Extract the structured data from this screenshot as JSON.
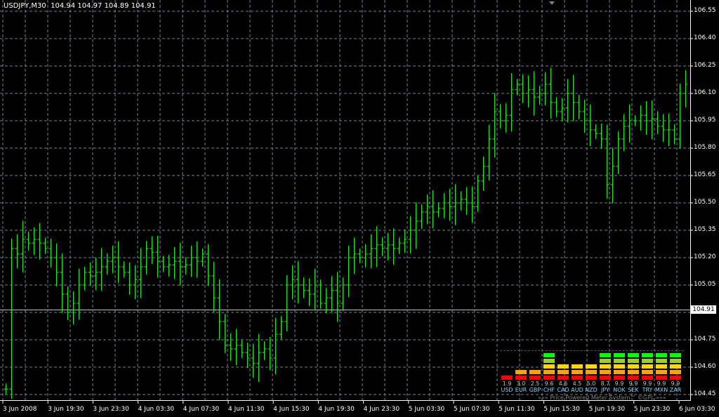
{
  "header": {
    "symbol": "USDJPY,M30",
    "open": "104.94",
    "high": "104.97",
    "low": "104.89",
    "close": "104.91"
  },
  "current_price": "104.91",
  "colors": {
    "bar": "#00ff00",
    "grid": "#708090",
    "axis": "#ffffff",
    "bid_line": "#c0c0c0"
  },
  "chart_data": {
    "type": "ohlc",
    "title": "USDJPY,M30",
    "ylim": [
      104.4,
      106.62
    ],
    "price_ticks": [
      "106.55",
      "106.40",
      "106.25",
      "106.10",
      "105.95",
      "105.80",
      "105.65",
      "105.50",
      "105.35",
      "105.20",
      "105.05",
      "104.90",
      "104.75",
      "104.60",
      "104.45"
    ],
    "time_ticks": [
      "3 Jun 2008",
      "3 Jun 19:30",
      "3 Jun 23:30",
      "4 Jun 03:30",
      "4 Jun 07:30",
      "4 Jun 11:30",
      "4 Jun 15:30",
      "4 Jun 19:30",
      "4 Jun 23:30",
      "5 Jun 03:30",
      "5 Jun 07:30",
      "5 Jun 11:30",
      "5 Jun 15:30",
      "5 Jun 19:30",
      "5 Jun 23:30",
      "6 Jun 03:30"
    ],
    "closes": [
      104.48,
      105.25,
      105.22,
      105.3,
      105.28,
      105.3,
      105.28,
      105.25,
      105.2,
      105.12,
      105.0,
      104.9,
      104.95,
      105.05,
      105.12,
      105.1,
      105.12,
      105.15,
      105.18,
      105.2,
      105.15,
      105.12,
      105.05,
      105.08,
      105.15,
      105.25,
      105.23,
      105.18,
      105.15,
      105.16,
      105.18,
      105.15,
      105.16,
      105.2,
      105.18,
      105.22,
      105.1,
      104.98,
      104.85,
      104.72,
      104.7,
      104.72,
      104.68,
      104.65,
      104.62,
      104.68,
      104.7,
      104.65,
      104.78,
      104.85,
      105.05,
      105.08,
      105.05,
      105.02,
      105.0,
      105.05,
      104.95,
      104.98,
      105.02,
      104.95,
      105.05,
      105.2,
      105.22,
      105.2,
      105.22,
      105.25,
      105.27,
      105.25,
      105.27,
      105.25,
      105.28,
      105.3,
      105.35,
      105.4,
      105.45,
      105.48,
      105.45,
      105.47,
      105.5,
      105.48,
      105.5,
      105.52,
      105.5,
      105.48,
      105.62,
      105.7,
      105.85,
      106.0,
      105.95,
      105.98,
      106.12,
      106.15,
      106.1,
      106.12,
      106.08,
      106.1,
      106.15,
      106.05,
      106.0,
      106.02,
      106.1,
      106.05,
      106.0,
      105.95,
      105.9,
      105.88,
      105.85,
      105.6,
      105.7,
      105.85,
      105.92,
      105.95,
      105.95,
      105.98,
      105.95,
      105.96,
      105.92,
      105.9,
      105.9,
      105.85,
      106.1,
      106.15
    ]
  },
  "meter": {
    "footer": "»»» Price Powered Meter System™ ©GPL «««",
    "level_colors": [
      "#ff0000",
      "#ffa500",
      "#ffd700",
      "#9acd32",
      "#00ff00"
    ],
    "currencies": [
      {
        "code": "USD",
        "value": "1.9",
        "level": 1
      },
      {
        "code": "EUR",
        "value": "3.0",
        "level": 2
      },
      {
        "code": "GBP",
        "value": "2.5",
        "level": 2
      },
      {
        "code": "CHF",
        "value": "9.6",
        "level": 5
      },
      {
        "code": "CAD",
        "value": "4.6",
        "level": 3
      },
      {
        "code": "AUD",
        "value": "4.5",
        "level": 3
      },
      {
        "code": "NZD",
        "value": "5.0",
        "level": 3
      },
      {
        "code": "JPY",
        "value": "8.7",
        "level": 5
      },
      {
        "code": "NOK",
        "value": "9.9",
        "level": 5
      },
      {
        "code": "SEK",
        "value": "9.9",
        "level": 5
      },
      {
        "code": "TRY",
        "value": "9.9",
        "level": 5
      },
      {
        "code": "MXN",
        "value": "9.9",
        "level": 5
      },
      {
        "code": "ZAR",
        "value": "9.9",
        "level": 5
      }
    ]
  }
}
